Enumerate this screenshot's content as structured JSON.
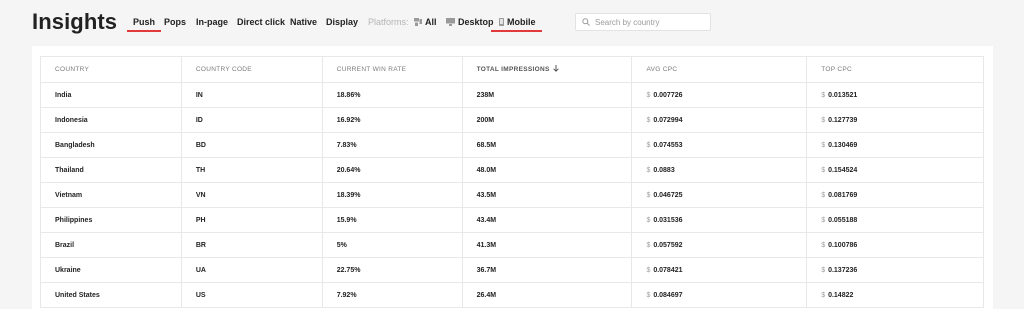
{
  "header": {
    "title": "Insights",
    "tabs": [
      {
        "label": "Push",
        "active": true
      },
      {
        "label": "Pops",
        "active": false
      },
      {
        "label": "In-page",
        "active": false
      },
      {
        "label": "Direct click",
        "active": false
      },
      {
        "label": "Native",
        "active": false
      },
      {
        "label": "Display",
        "active": false
      }
    ],
    "platforms_label": "Platforms:",
    "platforms": [
      {
        "label": "All",
        "icon": "all-platforms-icon",
        "active": false
      },
      {
        "label": "Desktop",
        "icon": "desktop-icon",
        "active": false
      },
      {
        "label": "Mobile",
        "icon": "mobile-icon",
        "active": true
      }
    ],
    "search": {
      "placeholder": "Search by country",
      "value": ""
    }
  },
  "table": {
    "columns": [
      "COUNTRY",
      "COUNTRY CODE",
      "CURRENT WIN RATE",
      "TOTAL IMPRESSIONS",
      "AVG CPC",
      "TOP CPC"
    ],
    "sorted_column": "TOTAL IMPRESSIONS",
    "currency_symbol": "$",
    "rows": [
      {
        "country": "India",
        "code": "IN",
        "win_rate": "18.86%",
        "impressions": "238M",
        "avg_cpc": "0.007726",
        "top_cpc": "0.013521"
      },
      {
        "country": "Indonesia",
        "code": "ID",
        "win_rate": "16.92%",
        "impressions": "200M",
        "avg_cpc": "0.072994",
        "top_cpc": "0.127739"
      },
      {
        "country": "Bangladesh",
        "code": "BD",
        "win_rate": "7.83%",
        "impressions": "68.5M",
        "avg_cpc": "0.074553",
        "top_cpc": "0.130469"
      },
      {
        "country": "Thailand",
        "code": "TH",
        "win_rate": "20.64%",
        "impressions": "48.0M",
        "avg_cpc": "0.0883",
        "top_cpc": "0.154524"
      },
      {
        "country": "Vietnam",
        "code": "VN",
        "win_rate": "18.39%",
        "impressions": "43.5M",
        "avg_cpc": "0.046725",
        "top_cpc": "0.081769"
      },
      {
        "country": "Philippines",
        "code": "PH",
        "win_rate": "15.9%",
        "impressions": "43.4M",
        "avg_cpc": "0.031536",
        "top_cpc": "0.055188"
      },
      {
        "country": "Brazil",
        "code": "BR",
        "win_rate": "5%",
        "impressions": "41.3M",
        "avg_cpc": "0.057592",
        "top_cpc": "0.100786"
      },
      {
        "country": "Ukraine",
        "code": "UA",
        "win_rate": "22.75%",
        "impressions": "36.7M",
        "avg_cpc": "0.078421",
        "top_cpc": "0.137236"
      },
      {
        "country": "United States",
        "code": "US",
        "win_rate": "7.92%",
        "impressions": "26.4M",
        "avg_cpc": "0.084697",
        "top_cpc": "0.14822"
      }
    ]
  },
  "colors": {
    "accent": "#e23a3a",
    "background": "#f5f5f5",
    "card": "#ffffff"
  }
}
